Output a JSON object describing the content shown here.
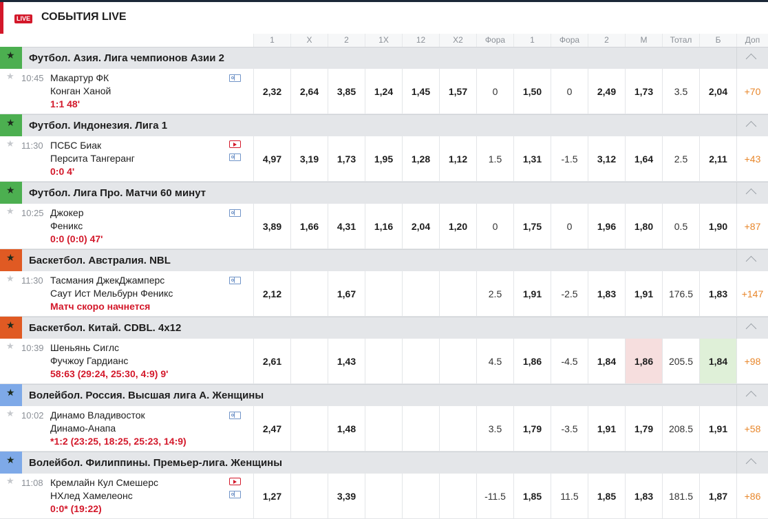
{
  "header": {
    "badge": "LIVE",
    "title": "СОБЫТИЯ LIVE"
  },
  "columns": [
    "1",
    "X",
    "2",
    "1X",
    "12",
    "X2",
    "Фора",
    "1",
    "Фора",
    "2",
    "М",
    "Тотал",
    "Б",
    "Доп"
  ],
  "colors": {
    "brand_red": "#d3182a",
    "football": "#4caf50",
    "basketball": "#e05a23",
    "volleyball": "#7ea9e8",
    "more": "#e8862a"
  },
  "leagues": [
    {
      "sport": "football",
      "name": "Футбол. Азия. Лига чемпионов Азии 2",
      "events": [
        {
          "time": "10:45",
          "team1": "Макартур ФК",
          "team2": "Конган Ханой",
          "score": "1:1 48'",
          "icons": [
            "stats"
          ],
          "cells": [
            "2,32",
            "2,64",
            "3,85",
            "1,24",
            "1,45",
            "1,57",
            "0",
            "1,50",
            "0",
            "2,49",
            "1,73",
            "3.5",
            "2,04",
            "+70"
          ]
        }
      ]
    },
    {
      "sport": "football",
      "name": "Футбол. Индонезия. Лига 1",
      "events": [
        {
          "time": "11:30",
          "team1": "ПСБС Биак",
          "team2": "Персита Тангеранг",
          "score": "0:0 4'",
          "icons": [
            "video",
            "stats"
          ],
          "cells": [
            "4,97",
            "3,19",
            "1,73",
            "1,95",
            "1,28",
            "1,12",
            "1.5",
            "1,31",
            "-1.5",
            "3,12",
            "1,64",
            "2.5",
            "2,11",
            "+43"
          ]
        }
      ]
    },
    {
      "sport": "football",
      "name": "Футбол. Лига Про. Матчи 60 минут",
      "events": [
        {
          "time": "10:25",
          "team1": "Джокер",
          "team2": "Феникс",
          "score": "0:0 (0:0) 47'",
          "icons": [
            "stats"
          ],
          "cells": [
            "3,89",
            "1,66",
            "4,31",
            "1,16",
            "2,04",
            "1,20",
            "0",
            "1,75",
            "0",
            "1,96",
            "1,80",
            "0.5",
            "1,90",
            "+87"
          ]
        }
      ]
    },
    {
      "sport": "basketball",
      "name": "Баскетбол. Австралия. NBL",
      "events": [
        {
          "time": "11:30",
          "team1": "Тасмания ДжекДжамперс",
          "team2": "Саут Ист Мельбурн Феникс",
          "score": "Матч скоро начнется",
          "icons": [
            "stats"
          ],
          "cells": [
            "2,12",
            "",
            "1,67",
            "",
            "",
            "",
            "2.5",
            "1,91",
            "-2.5",
            "1,83",
            "1,91",
            "176.5",
            "1,83",
            "+147"
          ]
        }
      ]
    },
    {
      "sport": "basketball",
      "name": "Баскетбол. Китай. CDBL. 4x12",
      "events": [
        {
          "time": "10:39",
          "team1": "Шеньянь Сиглс",
          "team2": "Фучжоу Гардианс",
          "score": "58:63 (29:24, 25:30, 4:9) 9'",
          "icons": [],
          "highlight": {
            "10": "red",
            "12": "green"
          },
          "cells": [
            "2,61",
            "",
            "1,43",
            "",
            "",
            "",
            "4.5",
            "1,86",
            "-4.5",
            "1,84",
            "1,86",
            "205.5",
            "1,84",
            "+98"
          ]
        }
      ]
    },
    {
      "sport": "volleyball",
      "name": "Волейбол. Россия. Высшая лига А. Женщины",
      "events": [
        {
          "time": "10:02",
          "team1": "Динамо Владивосток",
          "team2": "Динамо-Анапа",
          "score": "*1:2 (23:25, 18:25, 25:23, 14:9)",
          "icons": [
            "stats"
          ],
          "cells": [
            "2,47",
            "",
            "1,48",
            "",
            "",
            "",
            "3.5",
            "1,79",
            "-3.5",
            "1,91",
            "1,79",
            "208.5",
            "1,91",
            "+58"
          ]
        }
      ]
    },
    {
      "sport": "volleyball",
      "name": "Волейбол. Филиппины. Премьер-лига. Женщины",
      "events": [
        {
          "time": "11:08",
          "team1": "Кремлайн Кул Смешерс",
          "team2": "НХлед Хамелеонс",
          "score": "0:0* (19:22)",
          "icons": [
            "video",
            "stats"
          ],
          "cells": [
            "1,27",
            "",
            "3,39",
            "",
            "",
            "",
            "-11.5",
            "1,85",
            "11.5",
            "1,85",
            "1,83",
            "181.5",
            "1,87",
            "+86"
          ]
        }
      ]
    }
  ]
}
